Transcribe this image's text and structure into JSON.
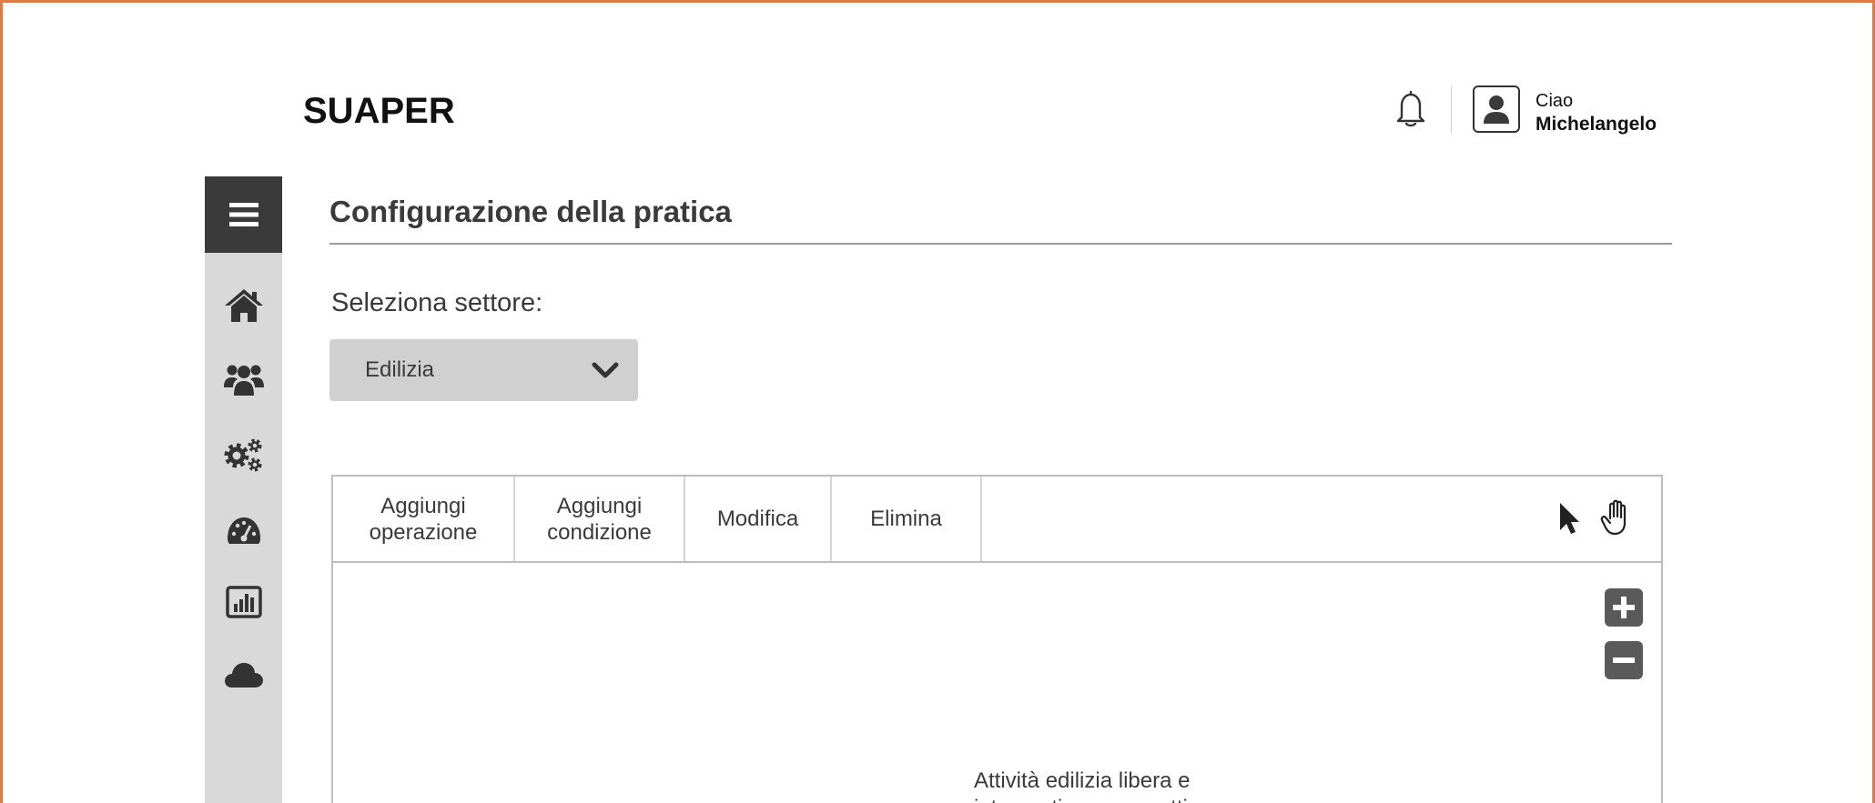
{
  "app": {
    "logo": "SUAPER"
  },
  "header": {
    "greeting": "Ciao",
    "user_name": "Michelangelo",
    "icons": [
      "bell-icon",
      "user-avatar-icon"
    ]
  },
  "sidebar": {
    "toggle_icon": "hamburger-icon",
    "items": [
      {
        "icon": "home-icon"
      },
      {
        "icon": "users-icon"
      },
      {
        "icon": "cogs-icon"
      },
      {
        "icon": "dashboard-gauge-icon"
      },
      {
        "icon": "bar-chart-icon"
      },
      {
        "icon": "cloud-icon"
      }
    ]
  },
  "main": {
    "title": "Configurazione della pratica",
    "sector_label": "Seleziona settore:",
    "sector_select": {
      "value": "Edilizia"
    }
  },
  "toolbar": {
    "add_operation": [
      "Aggiungi",
      "operazione"
    ],
    "add_condition": [
      "Aggiungi",
      "condizione"
    ],
    "edit": "Modifica",
    "delete": "Elimina",
    "tools": [
      "pointer-icon",
      "hand-icon"
    ]
  },
  "canvas": {
    "zoom": [
      "zoom-in-icon",
      "zoom-out-icon"
    ],
    "node_text": "Attività edilizia libera e interventi non soggetti"
  },
  "colors": {
    "frame": "#e07a45",
    "sidebar_bg": "#d9d9d9",
    "menu_toggle_bg": "#3a3a3a",
    "select_bg": "#d0d0d0"
  }
}
